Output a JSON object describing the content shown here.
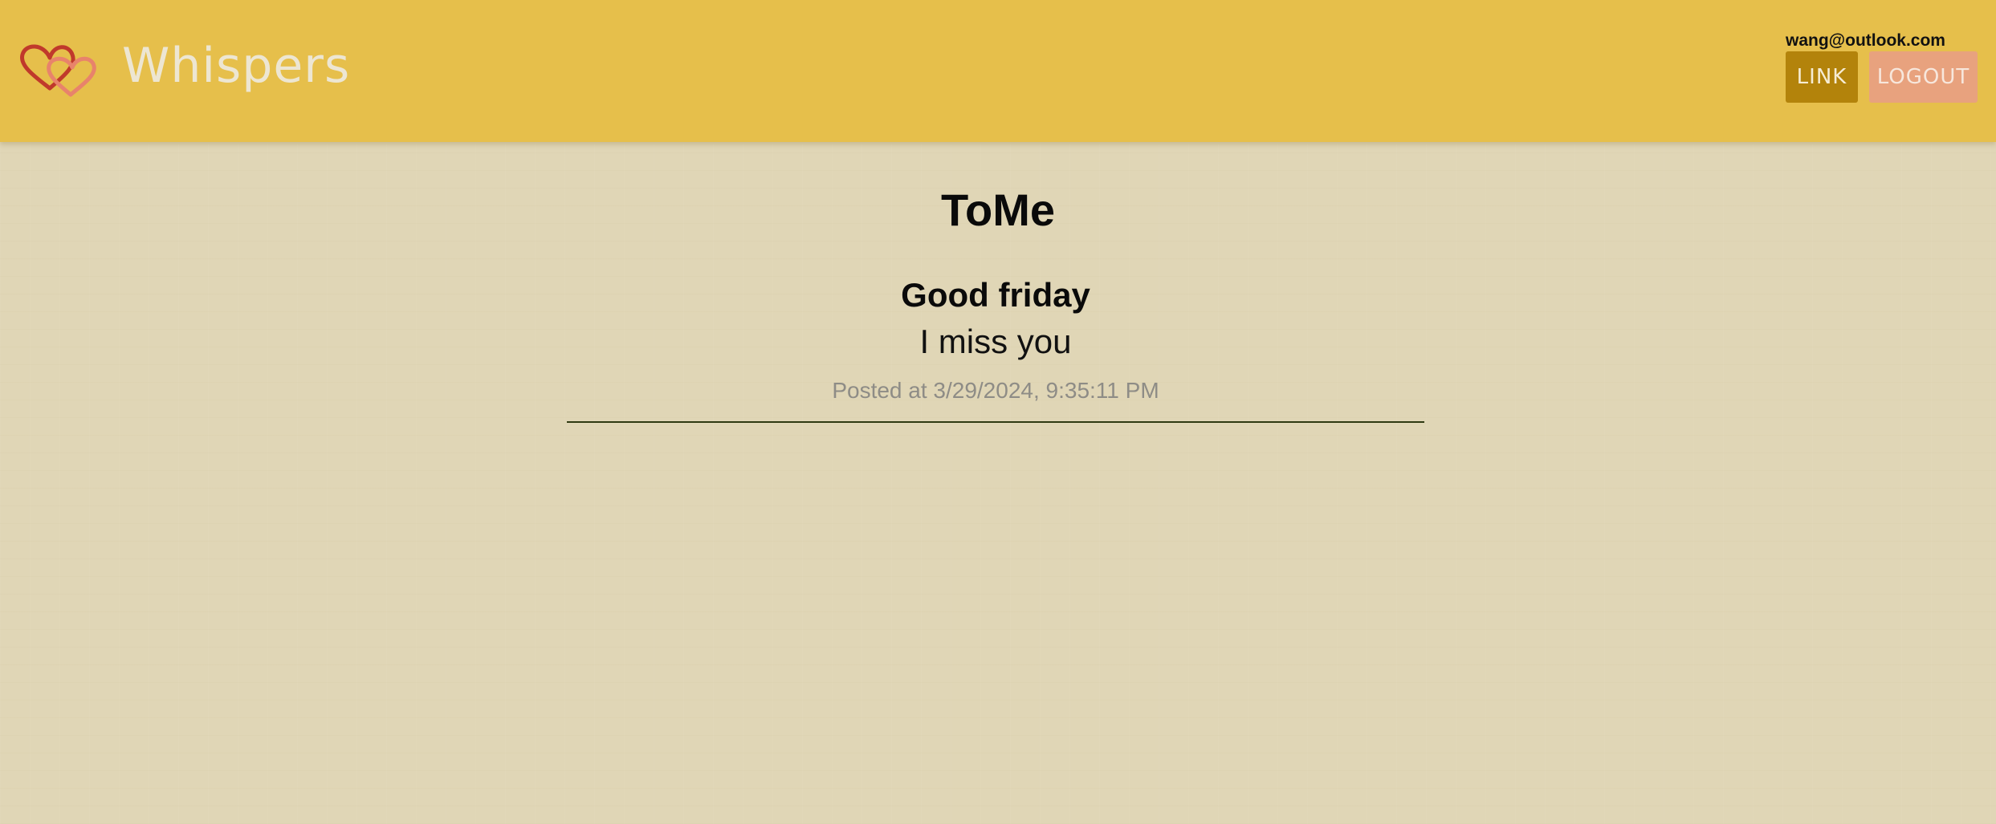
{
  "header": {
    "brand_name": "Whispers",
    "logo_icon": "two-hearts-icon",
    "user_email": "wang@outlook.com",
    "link_label": "LINK",
    "logout_label": "LOGOUT",
    "colors": {
      "header_bg": "#e6bf4b",
      "link_bg": "#b3830b",
      "logout_bg": "#e8a27e"
    }
  },
  "page": {
    "title": "ToMe",
    "background": "#e0d6b6"
  },
  "posts": [
    {
      "title": "Good friday",
      "body": "I miss you",
      "meta": "Posted at 3/29/2024, 9:35:11 PM"
    }
  ]
}
